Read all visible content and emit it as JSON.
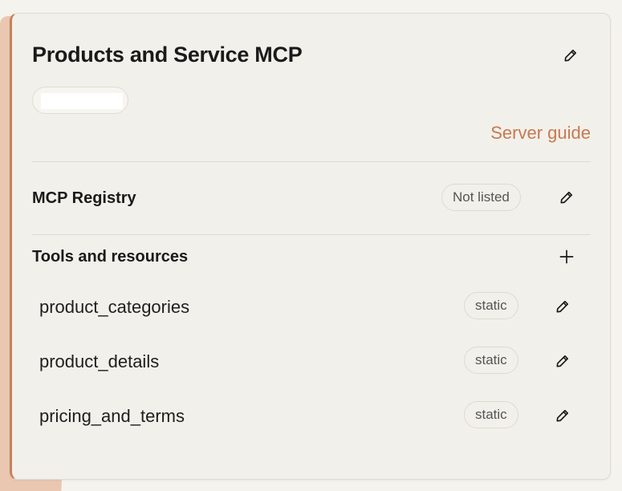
{
  "card": {
    "title": "Products and Service MCP",
    "server_guide_label": "Server guide"
  },
  "registry": {
    "label": "MCP Registry",
    "status": "Not listed"
  },
  "tools": {
    "label": "Tools and resources",
    "items": [
      {
        "name": "product_categories",
        "type": "static"
      },
      {
        "name": "product_details",
        "type": "static"
      },
      {
        "name": "pricing_and_terms",
        "type": "static"
      }
    ]
  },
  "colors": {
    "accent": "#c8794f",
    "card_border_left": "#c8805a",
    "background_shape": "#e9c7b0"
  },
  "icons": {
    "edit": "pencil-icon",
    "add": "plus-icon"
  }
}
